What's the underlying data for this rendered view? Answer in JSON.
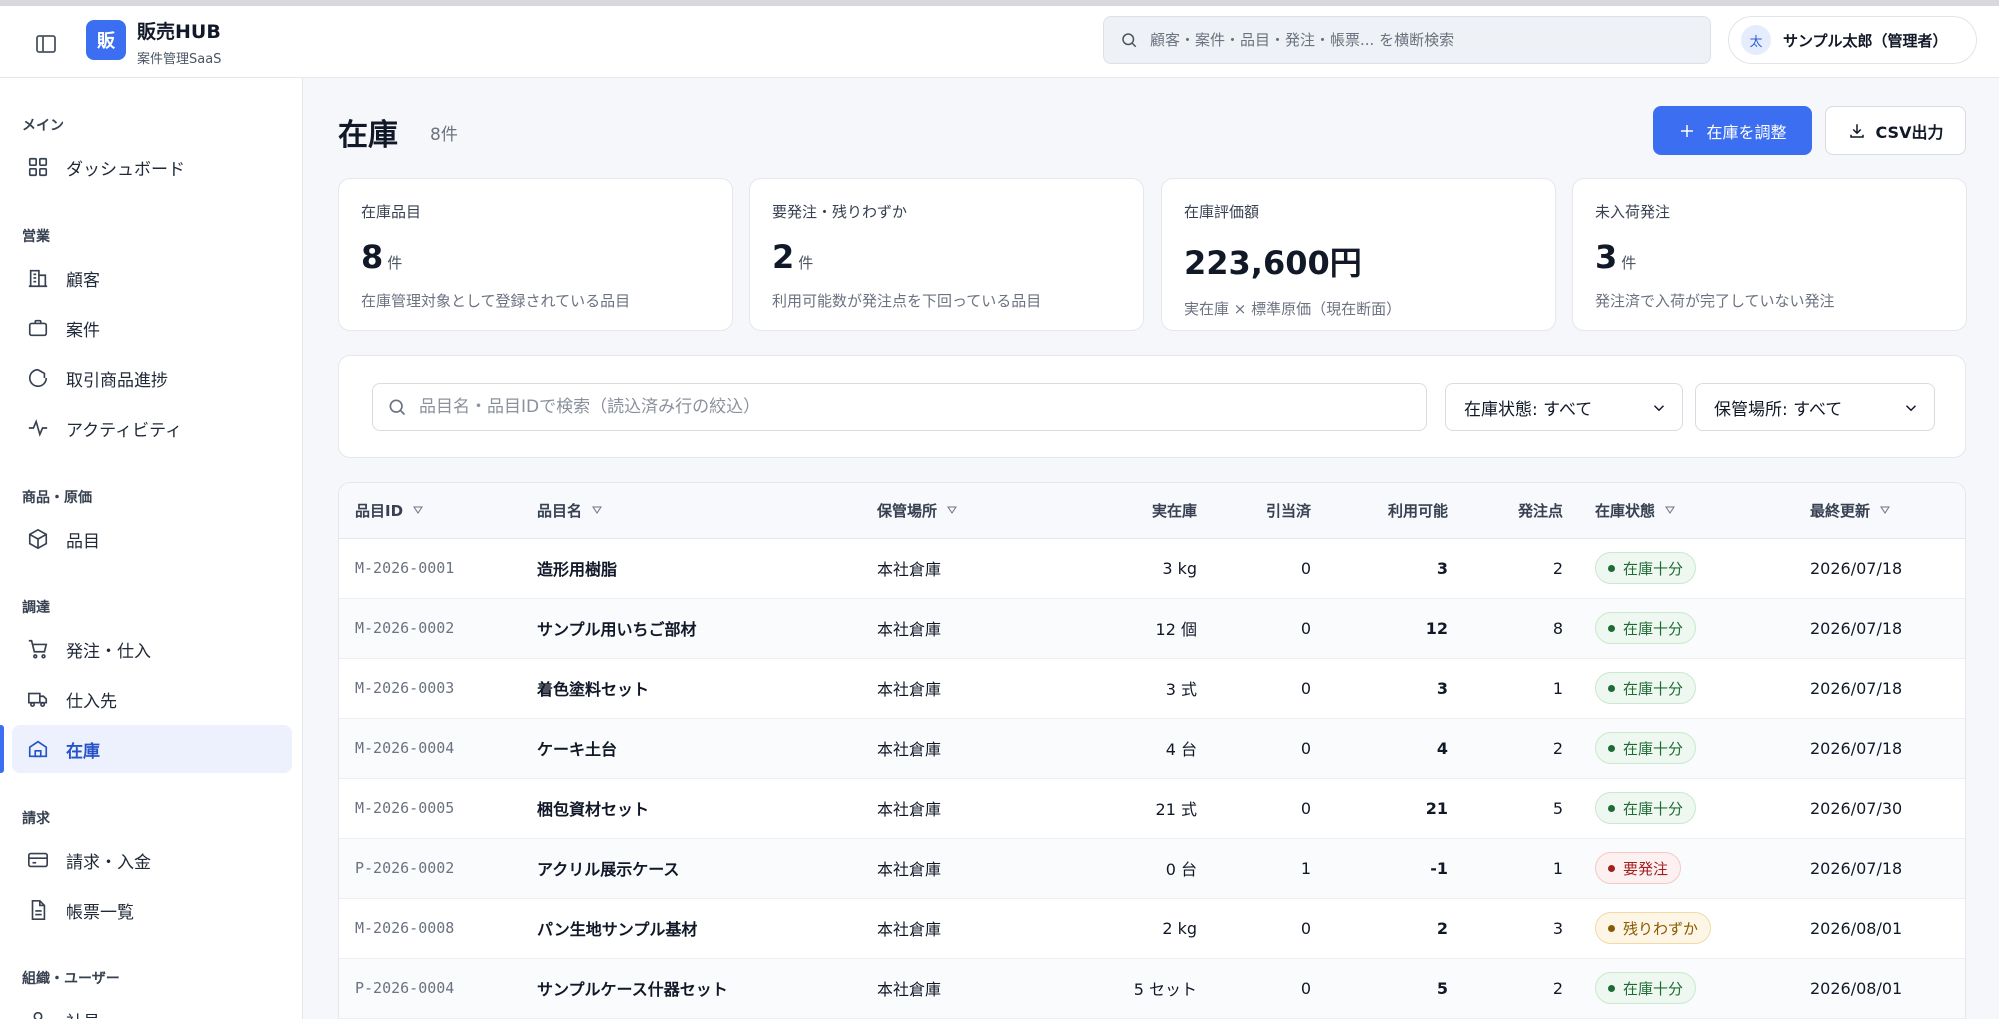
{
  "header": {
    "logo_char": "販",
    "app_title": "販売HUB",
    "app_subtitle": "案件管理SaaS",
    "search_placeholder": "顧客・案件・品目・発注・帳票... を横断検索",
    "user_avatar": "太",
    "user_name": "サンプル太郎（管理者）"
  },
  "sidebar": {
    "sections": [
      {
        "label": "メイン",
        "items": [
          {
            "label": "ダッシュボード",
            "icon": "grid-icon"
          }
        ]
      },
      {
        "label": "営業",
        "items": [
          {
            "label": "顧客",
            "icon": "building-icon"
          },
          {
            "label": "案件",
            "icon": "briefcase-icon"
          },
          {
            "label": "取引商品進捗",
            "icon": "progress-icon"
          },
          {
            "label": "アクティビティ",
            "icon": "activity-icon"
          }
        ]
      },
      {
        "label": "商品・原価",
        "items": [
          {
            "label": "品目",
            "icon": "box-icon"
          }
        ]
      },
      {
        "label": "調達",
        "items": [
          {
            "label": "発注・仕入",
            "icon": "cart-icon"
          },
          {
            "label": "仕入先",
            "icon": "truck-icon"
          },
          {
            "label": "在庫",
            "icon": "warehouse-icon",
            "active": true
          }
        ]
      },
      {
        "label": "請求",
        "items": [
          {
            "label": "請求・入金",
            "icon": "card-icon"
          },
          {
            "label": "帳票一覧",
            "icon": "document-icon"
          }
        ]
      },
      {
        "label": "組織・ユーザー",
        "items": [
          {
            "label": "社員",
            "icon": "user-icon"
          }
        ]
      }
    ]
  },
  "page": {
    "title": "在庫",
    "count": "8件",
    "adjust_button": "在庫を調整",
    "csv_button": "CSV出力"
  },
  "stats": [
    {
      "label": "在庫品目",
      "value": "8",
      "unit": "件",
      "desc": "在庫管理対象として登録されている品目"
    },
    {
      "label": "要発注・残りわずか",
      "value": "2",
      "unit": "件",
      "desc": "利用可能数が発注点を下回っている品目"
    },
    {
      "label": "在庫評価額",
      "value": "223,600円",
      "unit": "",
      "desc": "実在庫 × 標準原価（現在断面）"
    },
    {
      "label": "未入荷発注",
      "value": "3",
      "unit": "件",
      "desc": "発注済で入荷が完了していない発注"
    }
  ],
  "filters": {
    "search_placeholder": "品目名・品目IDで検索（読込済み行の絞込）",
    "status_select": "在庫状態: すべて",
    "location_select": "保管場所: すべて"
  },
  "table": {
    "columns": [
      "品目ID",
      "品目名",
      "保管場所",
      "実在庫",
      "引当済",
      "利用可能",
      "発注点",
      "在庫状態",
      "最終更新"
    ],
    "rows": [
      {
        "id": "M-2026-0001",
        "name": "造形用樹脂",
        "location": "本社倉庫",
        "stock": "3 kg",
        "reserved": "0",
        "available": "3",
        "reorder": "2",
        "status": "在庫十分",
        "status_type": "ok",
        "updated": "2026/07/18"
      },
      {
        "id": "M-2026-0002",
        "name": "サンプル用いちご部材",
        "location": "本社倉庫",
        "stock": "12 個",
        "reserved": "0",
        "available": "12",
        "reorder": "8",
        "status": "在庫十分",
        "status_type": "ok",
        "updated": "2026/07/18"
      },
      {
        "id": "M-2026-0003",
        "name": "着色塗料セット",
        "location": "本社倉庫",
        "stock": "3 式",
        "reserved": "0",
        "available": "3",
        "reorder": "1",
        "status": "在庫十分",
        "status_type": "ok",
        "updated": "2026/07/18"
      },
      {
        "id": "M-2026-0004",
        "name": "ケーキ土台",
        "location": "本社倉庫",
        "stock": "4 台",
        "reserved": "0",
        "available": "4",
        "reorder": "2",
        "status": "在庫十分",
        "status_type": "ok",
        "updated": "2026/07/18"
      },
      {
        "id": "M-2026-0005",
        "name": "梱包資材セット",
        "location": "本社倉庫",
        "stock": "21 式",
        "reserved": "0",
        "available": "21",
        "reorder": "5",
        "status": "在庫十分",
        "status_type": "ok",
        "updated": "2026/07/30"
      },
      {
        "id": "P-2026-0002",
        "name": "アクリル展示ケース",
        "location": "本社倉庫",
        "stock": "0 台",
        "reserved": "1",
        "available": "-1",
        "reorder": "1",
        "status": "要発注",
        "status_type": "danger",
        "updated": "2026/07/18"
      },
      {
        "id": "M-2026-0008",
        "name": "パン生地サンプル基材",
        "location": "本社倉庫",
        "stock": "2 kg",
        "reserved": "0",
        "available": "2",
        "reorder": "3",
        "status": "残りわずか",
        "status_type": "warn",
        "updated": "2026/08/01"
      },
      {
        "id": "P-2026-0004",
        "name": "サンプルケース什器セット",
        "location": "本社倉庫",
        "stock": "5 セット",
        "reserved": "0",
        "available": "5",
        "reorder": "2",
        "status": "在庫十分",
        "status_type": "ok",
        "updated": "2026/08/01"
      }
    ]
  },
  "colors": {
    "accent": "#3b6ef0",
    "ok": "#1f6b34",
    "danger": "#a21f1f",
    "warn": "#8a5a00"
  }
}
